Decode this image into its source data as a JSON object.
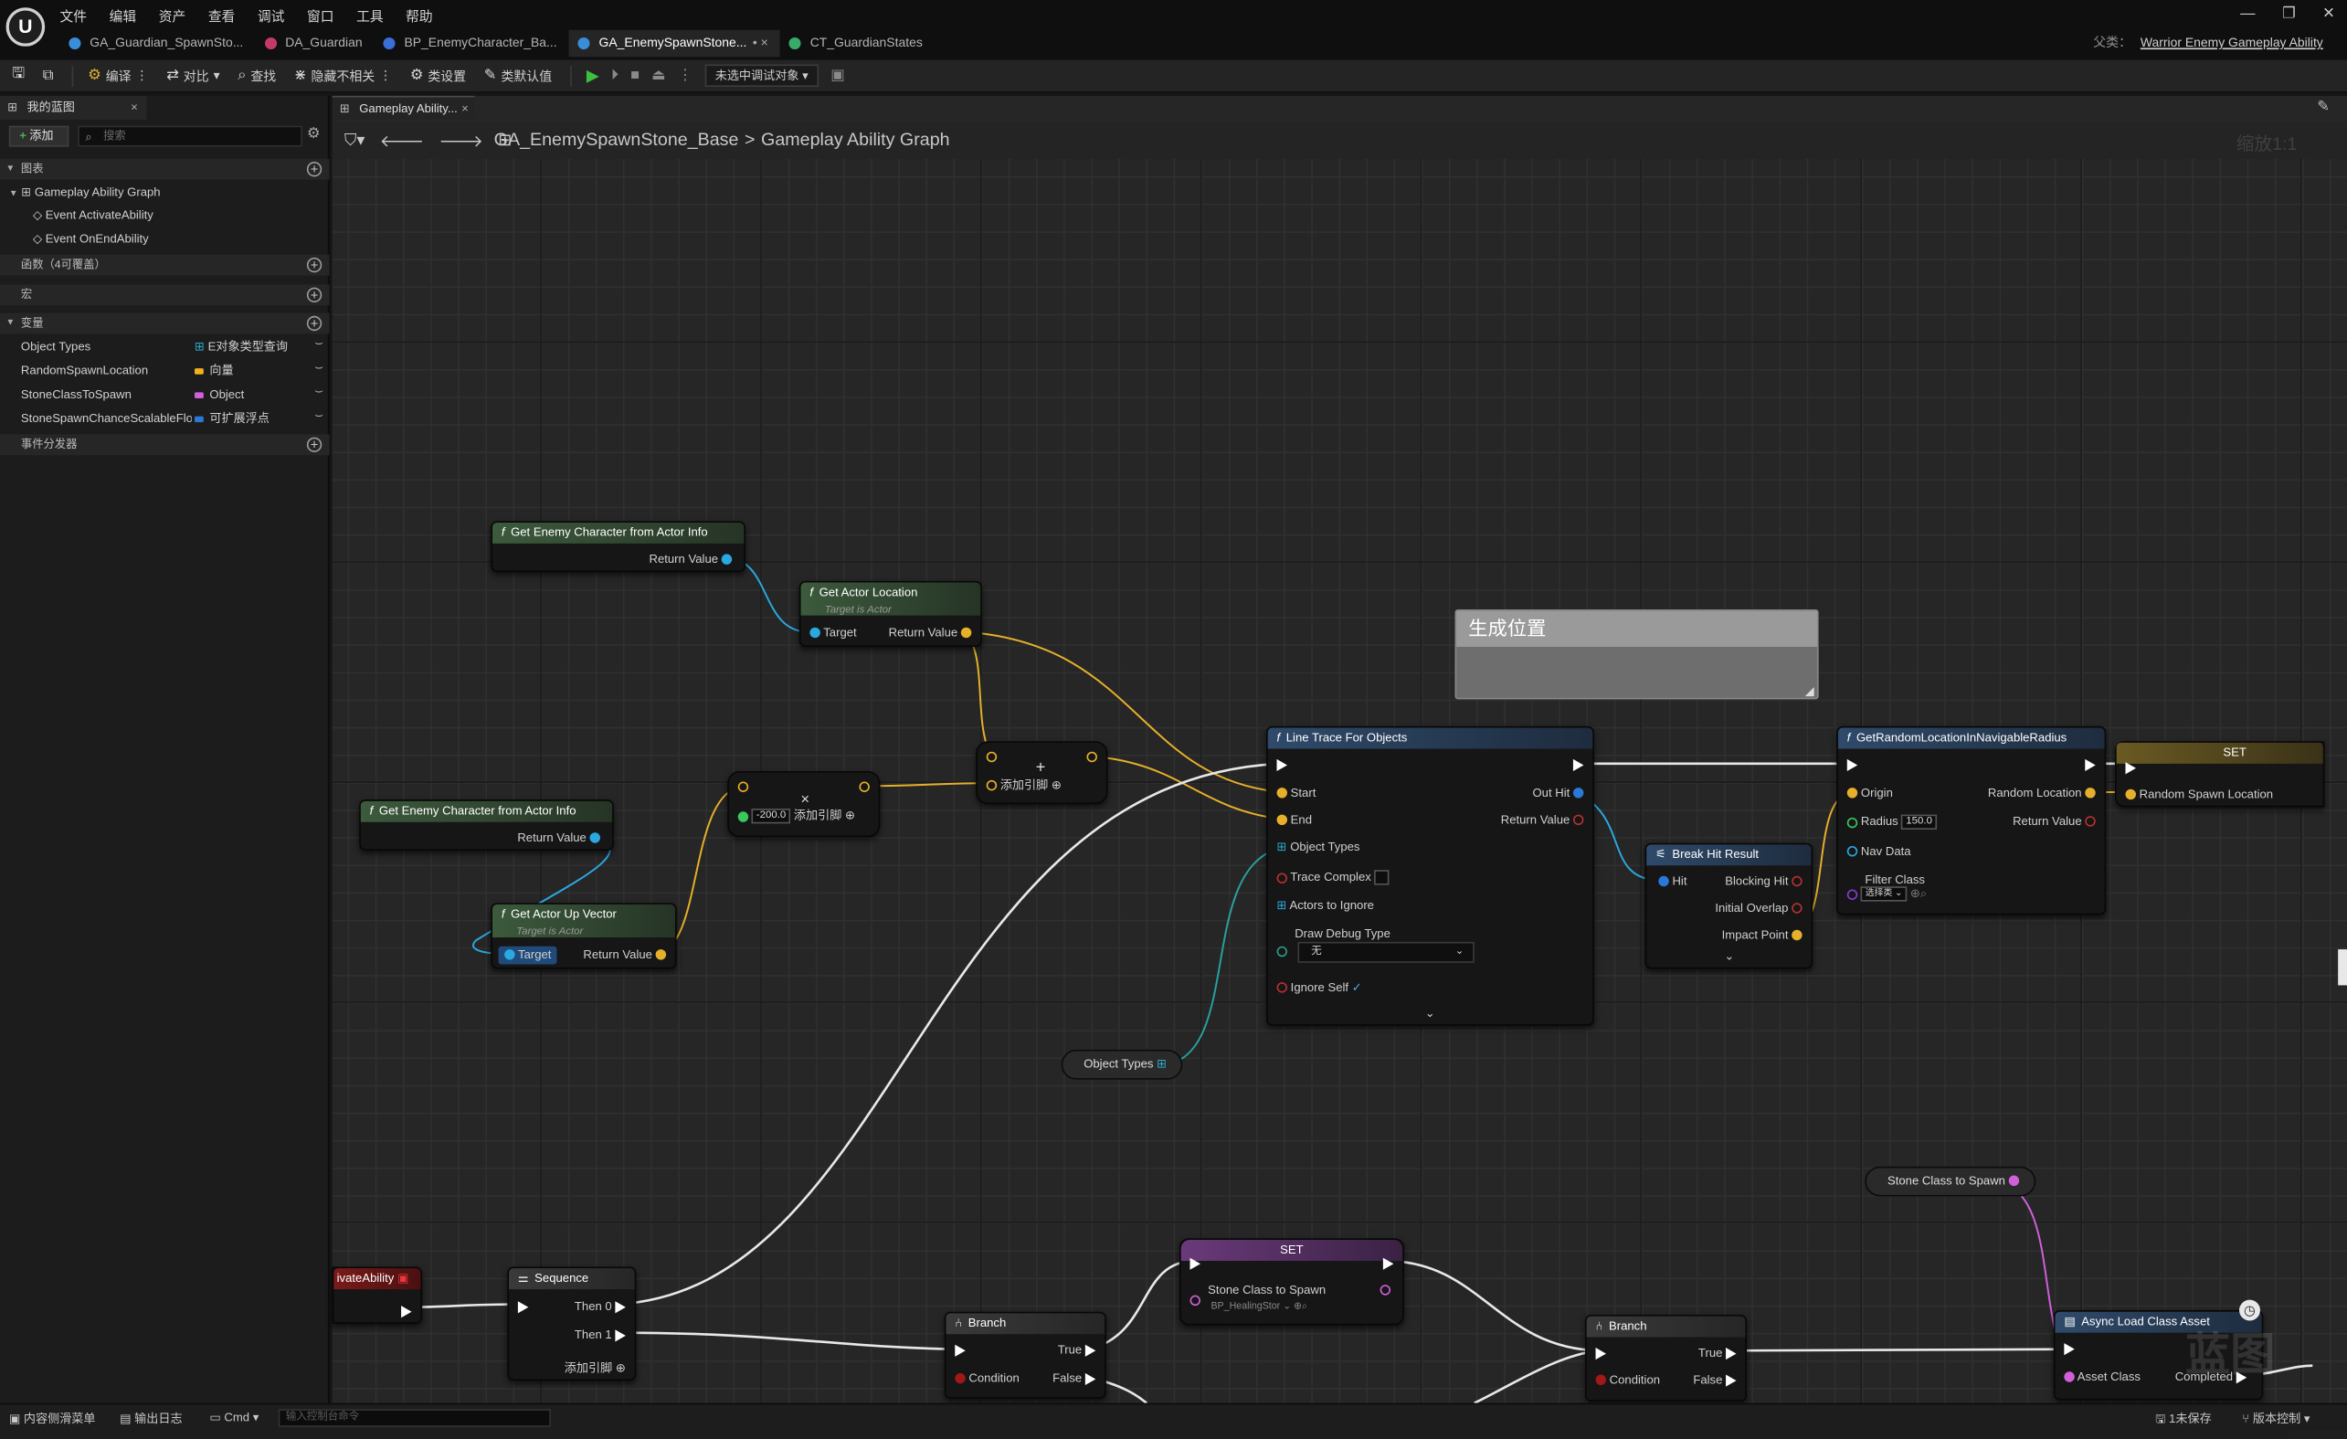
{
  "app": {
    "logo": "U"
  },
  "menu": [
    "文件",
    "编辑",
    "资产",
    "查看",
    "调试",
    "窗口",
    "工具",
    "帮助"
  ],
  "tabs": [
    {
      "label": "GA_Guardian_SpawnSto...",
      "color": "#3a8ed8",
      "active": false
    },
    {
      "label": "DA_Guardian",
      "color": "#c23a6a",
      "active": false
    },
    {
      "label": "BP_EnemyCharacter_Ba...",
      "color": "#3a6ed8",
      "active": false
    },
    {
      "label": "GA_EnemySpawnStone...",
      "color": "#3a8ed8",
      "active": true,
      "suffix": "• ×"
    },
    {
      "label": "CT_GuardianStates",
      "color": "#3aaa6a",
      "active": false
    }
  ],
  "window_buttons": [
    "—",
    "❐",
    "✕"
  ],
  "parent": {
    "label": "父类：",
    "value": "Warrior Enemy Gameplay Ability"
  },
  "toolbar": {
    "compile": "编译",
    "diff": "对比",
    "find": "查找",
    "hide_unrelated": "隐藏不相关",
    "class_settings": "类设置",
    "class_defaults": "类默认值",
    "debug_object": "未选中调试对象"
  },
  "left_panel": {
    "tab": "我的蓝图",
    "add": "添加",
    "search_placeholder": "搜索",
    "graphs_header": "图表",
    "graph_name": "Gameplay Ability Graph",
    "events": [
      "Event ActivateAbility",
      "Event OnEndAbility"
    ],
    "functions_header": "函数（4可覆盖）",
    "macros_header": "宏",
    "variables_header": "变量",
    "variables": [
      {
        "name": "Object Types",
        "type": "E对象类型查询",
        "color": "#2aa8c8"
      },
      {
        "name": "RandomSpawnLocation",
        "type": "向量",
        "color": "#f0b020"
      },
      {
        "name": "StoneClassToSpawn",
        "type": "Object",
        "color": "#d060d8"
      },
      {
        "name": "StoneSpawnChanceScalableFloa",
        "type": "可扩展浮点",
        "color": "#2a78d8"
      }
    ],
    "dispatchers_header": "事件分发器"
  },
  "editor": {
    "tab": "Gameplay Ability...",
    "crumb_asset": "GA_EnemySpawnStone_Base",
    "crumb_graph": "Gameplay Ability Graph",
    "zoom": "缩放1:1"
  },
  "nodes": {
    "get_enemy_1": {
      "title": "Get Enemy Character from Actor Info",
      "ret": "Return Value"
    },
    "get_actor_location": {
      "title": "Get Actor Location",
      "subtitle": "Target is Actor",
      "target": "Target",
      "ret": "Return Value"
    },
    "get_enemy_2": {
      "title": "Get Enemy Character from Actor Info",
      "ret": "Return Value"
    },
    "get_actor_up": {
      "title": "Get Actor Up Vector",
      "subtitle": "Target is Actor",
      "target": "Target",
      "ret": "Return Value"
    },
    "multiply": {
      "value": "-200.0",
      "add_pin": "添加引脚"
    },
    "add": {
      "add_pin": "添加引脚"
    },
    "comment": {
      "text": "生成位置"
    },
    "line_trace": {
      "title": "Line Trace For Objects",
      "start": "Start",
      "end": "End",
      "object_types": "Object Types",
      "trace_complex": "Trace Complex",
      "actors_to_ignore": "Actors to Ignore",
      "draw_debug_type": "Draw Debug Type",
      "draw_debug_value": "无",
      "ignore_self": "Ignore Self",
      "out_hit": "Out Hit",
      "ret": "Return Value"
    },
    "break_hit": {
      "title": "Break Hit Result",
      "hit": "Hit",
      "blocking_hit": "Blocking Hit",
      "initial_overlap": "Initial Overlap",
      "impact_point": "Impact Point"
    },
    "random_loc": {
      "title": "GetRandomLocationInNavigableRadius",
      "origin": "Origin",
      "radius": "Radius",
      "radius_value": "150.0",
      "nav_data": "Nav Data",
      "filter_class": "Filter Class",
      "filter_value": "选择类",
      "random_location": "Random Location",
      "ret": "Return Value"
    },
    "set_1": {
      "title": "SET",
      "pin": "Random Spawn Location"
    },
    "object_types_var": {
      "label": "Object Types"
    },
    "stone_class_var": {
      "label": "Stone Class to Spawn"
    },
    "activate": {
      "title": "ivateAbility"
    },
    "sequence": {
      "title": "Sequence",
      "then0": "Then 0",
      "then1": "Then 1",
      "add_pin": "添加引脚"
    },
    "branch_1": {
      "title": "Branch",
      "condition": "Condition",
      "true": "True",
      "false": "False"
    },
    "set_2": {
      "title": "SET",
      "pin": "Stone Class to Spawn",
      "value": "BP_HealingStor"
    },
    "branch_2": {
      "title": "Branch",
      "condition": "Condition",
      "true": "True",
      "false": "False"
    },
    "async_load": {
      "title": "Async Load Class Asset",
      "asset_class": "Asset Class",
      "completed": "Completed"
    }
  },
  "status": {
    "content_drawer": "内容侧滑菜单",
    "output_log": "输出日志",
    "cmd": "Cmd",
    "cmd_placeholder": "输入控制台命令",
    "unsaved": "1未保存",
    "source_control": "版本控制"
  },
  "watermark": "蓝图"
}
